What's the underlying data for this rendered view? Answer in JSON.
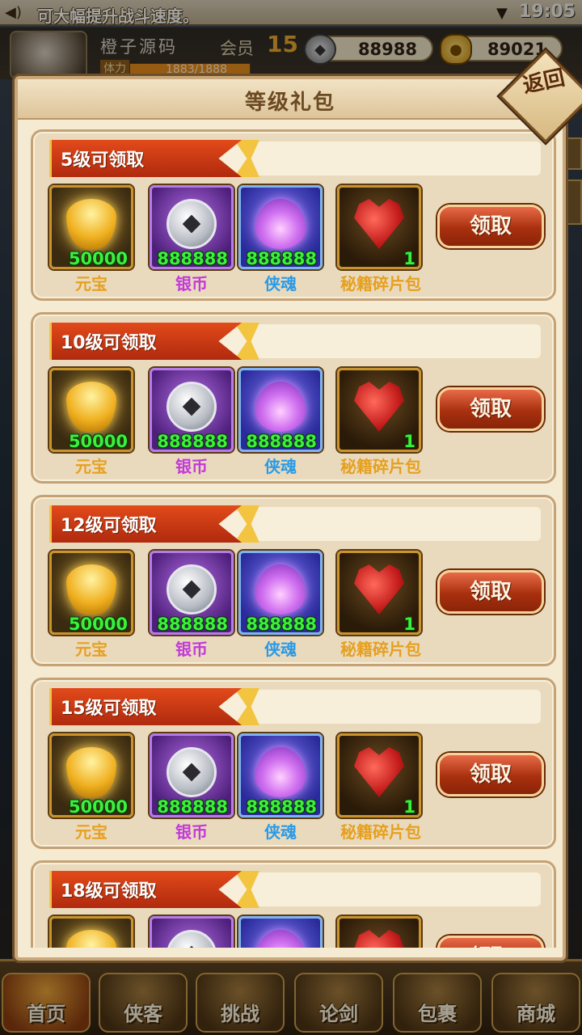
{
  "status_bar": {
    "marquee": "可大幅提升战斗速度。",
    "time": "19:05"
  },
  "player": {
    "name": "橙子源码",
    "vip_label": "会员",
    "vip_level": "15",
    "power_label": "体力",
    "stamina": "1883/1888",
    "silver": "88988",
    "gold": "89021"
  },
  "dialog": {
    "title": "等级礼包",
    "back_label": "返回"
  },
  "item_names": {
    "yuanbao": "元宝",
    "silver": "银币",
    "soul": "侠魂",
    "gift": "秘籍碎片包"
  },
  "claim_label": "领取",
  "rewards": [
    {
      "title": "5级可领取",
      "yuanbao_qty": "50000",
      "silver_qty": "888888",
      "soul_qty": "888888",
      "gift_qty": "1"
    },
    {
      "title": "10级可领取",
      "yuanbao_qty": "50000",
      "silver_qty": "888888",
      "soul_qty": "888888",
      "gift_qty": "1"
    },
    {
      "title": "12级可领取",
      "yuanbao_qty": "50000",
      "silver_qty": "888888",
      "soul_qty": "888888",
      "gift_qty": "1"
    },
    {
      "title": "15级可领取",
      "yuanbao_qty": "50000",
      "silver_qty": "888888",
      "soul_qty": "888888",
      "gift_qty": "1"
    },
    {
      "title": "18级可领取",
      "yuanbao_qty": "",
      "silver_qty": "",
      "soul_qty": "",
      "gift_qty": ""
    }
  ],
  "bottom_nav": {
    "home": "首页",
    "hero": "侠客",
    "challenge": "挑战",
    "duel": "论剑",
    "bag": "包裹",
    "shop": "商城"
  },
  "icons": {
    "speaker": "speaker-icon",
    "wifi": "wifi-icon",
    "silver": "silver-coin-icon",
    "gold": "gold-ingot-icon"
  }
}
